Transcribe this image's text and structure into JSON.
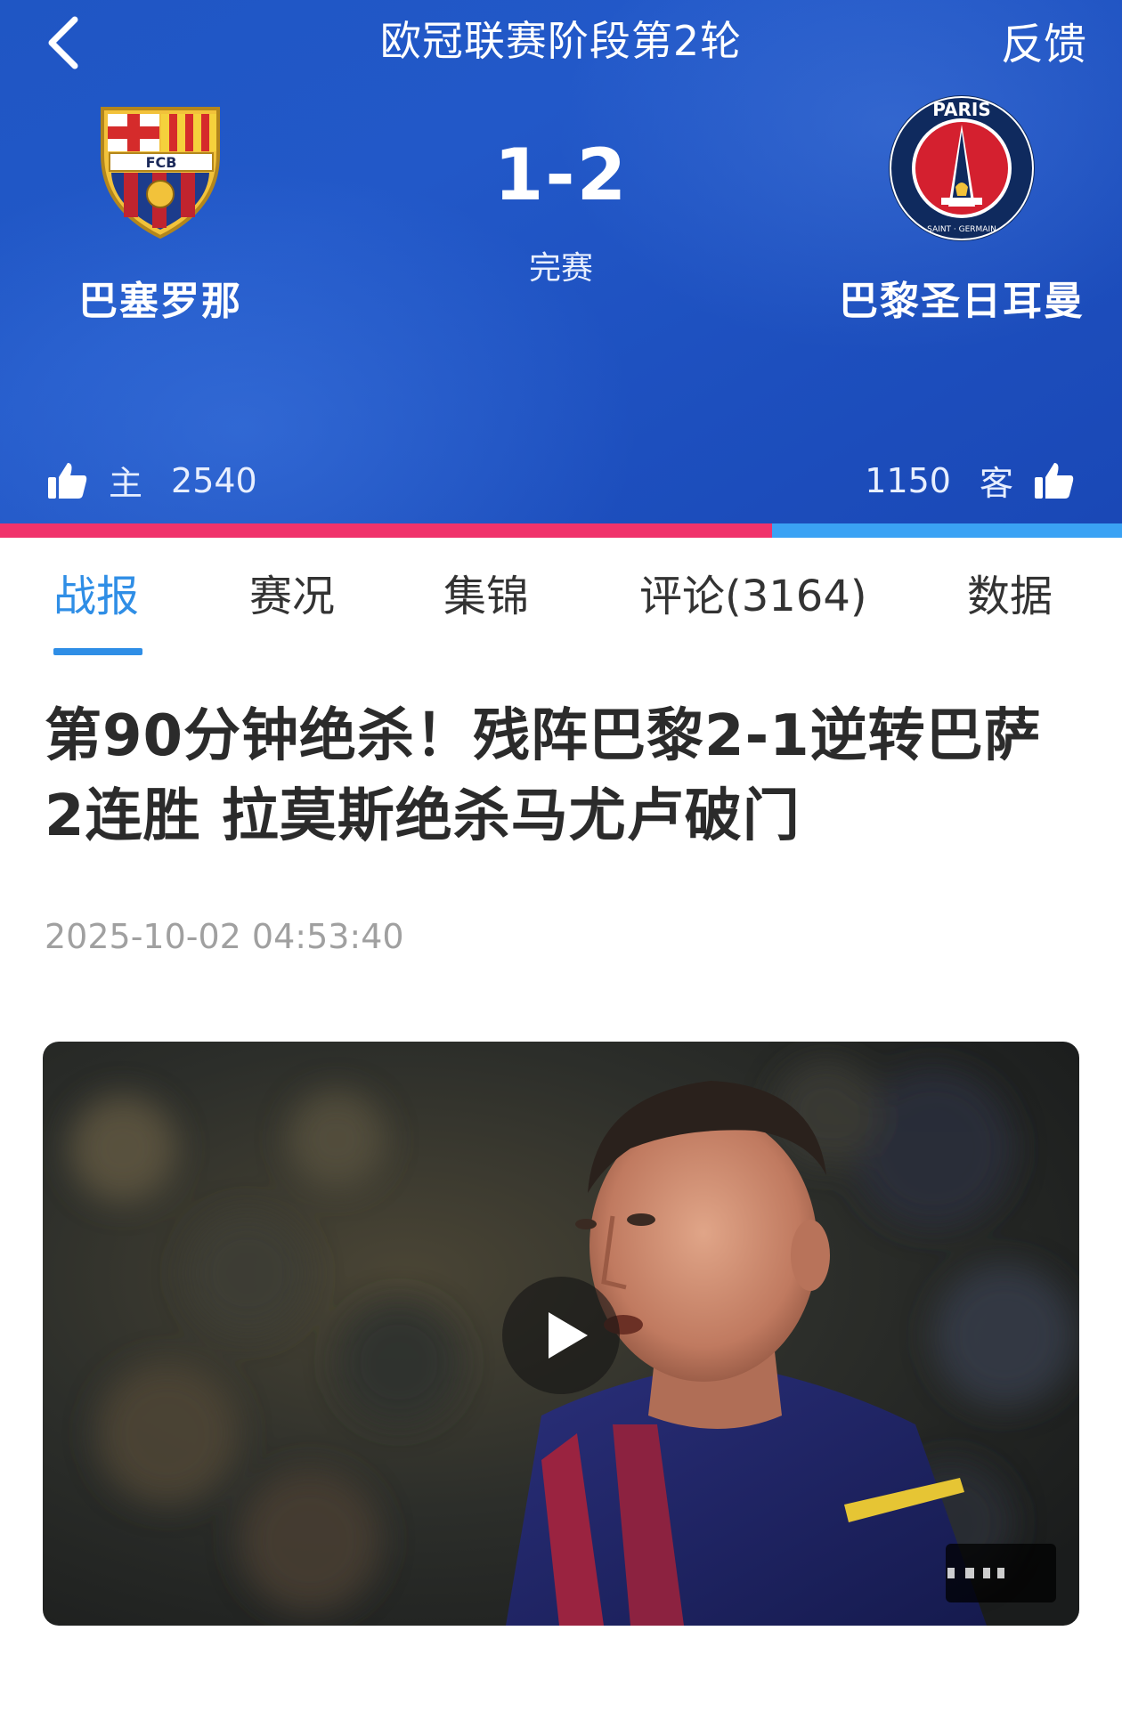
{
  "header": {
    "title": "欧冠联赛阶段第2轮",
    "feedback_label": "反馈",
    "home_team": {
      "name": "巴塞罗那",
      "logo_text": "FCB"
    },
    "away_team": {
      "name": "巴黎圣日耳曼",
      "logo_text_top": "PARIS",
      "logo_text_bottom": "SAINT · GERMAIN"
    },
    "score": "1-2",
    "status": "完赛",
    "home_vote": {
      "label": "主",
      "count": "2540"
    },
    "away_vote": {
      "label": "客",
      "count": "1150"
    },
    "support_ratio_home": 0.688,
    "colors": {
      "home_bar": "#f0336b",
      "away_bar": "#3aa2f4",
      "accent": "#2f8ee6"
    }
  },
  "tabs": [
    {
      "label": "战报",
      "active": true
    },
    {
      "label": "赛况",
      "active": false
    },
    {
      "label": "集锦",
      "active": false
    },
    {
      "label": "评论(3164)",
      "active": false
    },
    {
      "label": "数据",
      "active": false
    }
  ],
  "article": {
    "headline_line1": "第90分钟绝杀！残阵巴黎2-1逆转巴萨",
    "headline_line2": "2连胜 拉莫斯绝杀马尤卢破门",
    "timestamp": "2025-10-02 04:53:40"
  },
  "video": {
    "icons": {
      "play": "play-icon"
    }
  }
}
